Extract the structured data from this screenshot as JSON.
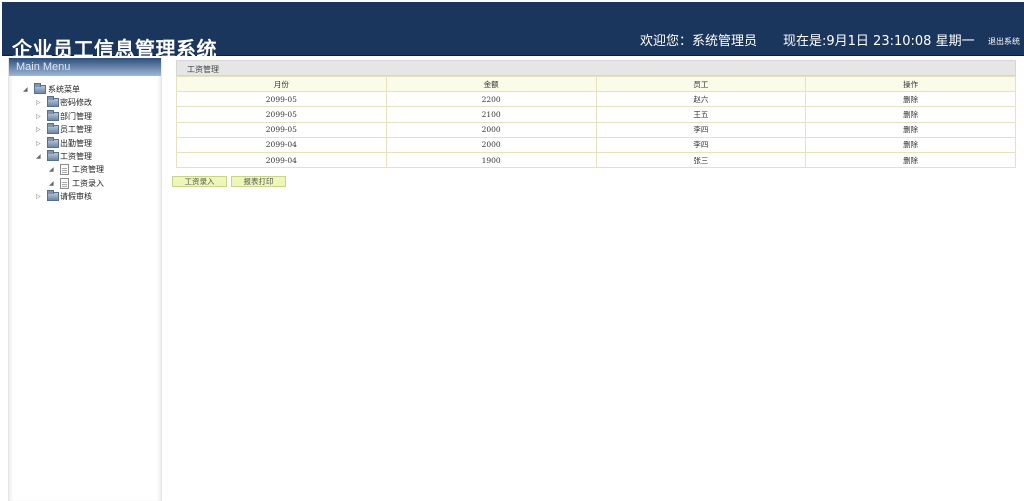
{
  "header": {
    "app_title": "企业员工信息管理系统",
    "welcome": "欢迎您：系统管理员",
    "clock": "现在是:9月1日 23:10:08 星期一",
    "logout": "退出系统"
  },
  "sidebar": {
    "title": "Main Menu",
    "tree": {
      "root": "系统菜单",
      "items": [
        {
          "label": "密码修改",
          "expanded": false
        },
        {
          "label": "部门管理",
          "expanded": false
        },
        {
          "label": "员工管理",
          "expanded": false
        },
        {
          "label": "出勤管理",
          "expanded": false
        },
        {
          "label": "工资管理",
          "expanded": true,
          "children": [
            "工资管理",
            "工资录入"
          ]
        },
        {
          "label": "请假审核",
          "expanded": false
        }
      ]
    }
  },
  "main": {
    "panel_title": "工资管理",
    "table": {
      "headers": [
        "月份",
        "金额",
        "员工",
        "操作"
      ],
      "rows": [
        [
          "2099-05",
          "2200",
          "赵六",
          "删除"
        ],
        [
          "2099-05",
          "2100",
          "王五",
          "删除"
        ],
        [
          "2099-05",
          "2000",
          "李四",
          "删除"
        ],
        [
          "2099-04",
          "2000",
          "李四",
          "删除"
        ],
        [
          "2099-04",
          "1900",
          "张三",
          "删除"
        ]
      ]
    },
    "buttons": {
      "salary_entry": "工资录入",
      "report_print": "报表打印"
    }
  },
  "colors": {
    "header_bg": "#1b365d",
    "table_header_bg": "#fbfbe9",
    "table_border": "#e7e1bf",
    "button_bg": "#eef7b8"
  }
}
